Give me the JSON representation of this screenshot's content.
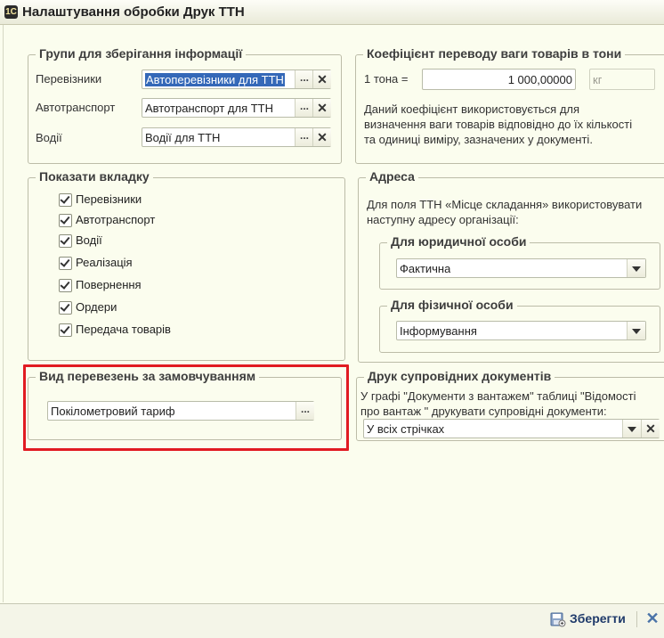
{
  "window": {
    "title": "Налаштування обробки Друк ТТН",
    "icon": "app-icon"
  },
  "groups_storage": {
    "title": "Групи для зберігання інформації",
    "rows": [
      {
        "label": "Перевізники",
        "value": "Автоперевізники для ТТН"
      },
      {
        "label": "Автотранспорт",
        "value": "Автотранспорт для ТТН"
      },
      {
        "label": "Водії",
        "value": "Водії для ТТН"
      }
    ],
    "dots": "...",
    "clear": "✕"
  },
  "coefficient": {
    "title": "Коефіцієнт переводу ваги товарів в тони",
    "label": "1 тона =",
    "value": "1 000,00000",
    "unit_placeholder": "кг",
    "note_lines": [
      "Даний коефіцієнт використовується для",
      "визначення ваги товарів відповідно до їх кількості",
      "та одиниці виміру, зазначених у документі."
    ]
  },
  "show_tab": {
    "title": "Показати вкладку",
    "items": [
      {
        "label": "Перевізники",
        "checked": true
      },
      {
        "label": "Автотранспорт",
        "checked": true
      },
      {
        "label": "Водії",
        "checked": true
      },
      {
        "label": "Реалізація",
        "checked": true
      },
      {
        "label": "Повернення",
        "checked": true
      },
      {
        "label": "Ордери",
        "checked": true
      },
      {
        "label": "Передача товарів",
        "checked": true
      }
    ]
  },
  "address": {
    "title": "Адреса",
    "note_lines": [
      "Для поля ТТН «Місце складання» використовувати",
      "наступну адресу організації:"
    ],
    "legal": {
      "title": "Для юридичної особи",
      "value": "Фактична"
    },
    "physical": {
      "title": "Для фізичної особи",
      "value": "Інформування"
    }
  },
  "transport_type": {
    "title": "Вид перевезень за замовчуванням",
    "value": "Покілометровий тариф",
    "dots": "..."
  },
  "print_docs": {
    "title": "Друк супровідних документів",
    "note_lines": [
      "У графі \"Документи з вантажем\" таблиці \"Відомості",
      "про вантаж \" друкувати супровідні документи:"
    ],
    "value": "У всіх стрічках"
  },
  "footer": {
    "save_label": "Зберегти",
    "close": "✕"
  },
  "colors": {
    "highlight_border": "#e11b22",
    "selection": "#3468b8",
    "background": "#fbfdee"
  }
}
